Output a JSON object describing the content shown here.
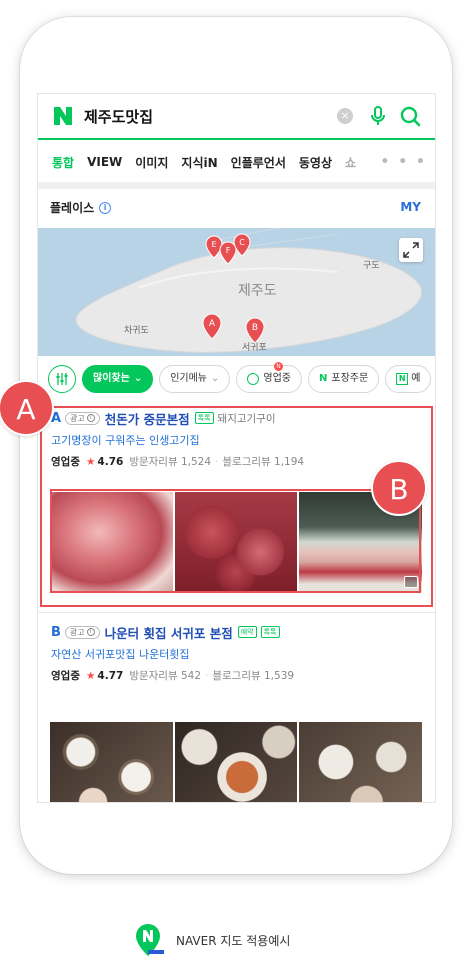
{
  "search": {
    "query": "제주도맛집"
  },
  "tabs": [
    "통합",
    "VIEW",
    "이미지",
    "지식iN",
    "인플루언서",
    "동영상",
    "쇼"
  ],
  "place": {
    "title": "플레이스",
    "my_label": "MY"
  },
  "map": {
    "region_label": "제주도",
    "labels": [
      "구도",
      "차귀도",
      "서귀포"
    ],
    "markers": [
      "E",
      "F",
      "C",
      "A",
      "B"
    ]
  },
  "chips": {
    "popular": "많이찾는",
    "menu": "인기메뉴",
    "open": "영업중",
    "open_badge": "N",
    "takeout": "포장주문",
    "more": "예"
  },
  "results": [
    {
      "letter": "A",
      "ad_label": "광고",
      "name": "천돈가 중문본점",
      "tags": [
        "톡톡"
      ],
      "category": "돼지고기구이",
      "sub_link": "고기명장이 구워주는 인생고기집",
      "status": "영업중",
      "rating": "4.76",
      "visitor_reviews": "방문자리뷰 1,524",
      "blog_reviews": "블로그리뷰 1,194"
    },
    {
      "letter": "B",
      "ad_label": "광고",
      "name": "나운터 횟집 서귀포 본점",
      "tags": [
        "예약",
        "톡톡"
      ],
      "category": "",
      "sub_link": "자연산 서귀포맛집 나운터횟집",
      "status": "영업중",
      "rating": "4.77",
      "visitor_reviews": "방문자리뷰 542",
      "blog_reviews": "블로그리뷰 1,539"
    }
  ],
  "annotations": [
    "A",
    "B"
  ],
  "footer": {
    "caption": "NAVER 지도 적용예시"
  },
  "colors": {
    "accent": "#03c75a",
    "link": "#1f6fd6",
    "annotation": "#e84f52",
    "star": "#ff4b4b"
  }
}
